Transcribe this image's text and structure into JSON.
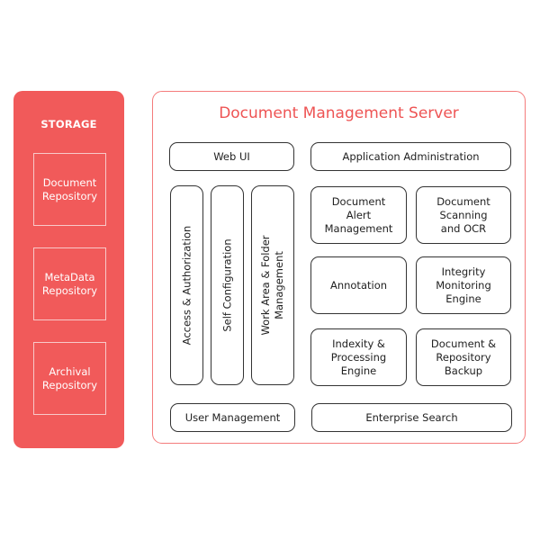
{
  "storage": {
    "title": "STORAGE",
    "repositories": [
      {
        "line1": "Document",
        "line2": "Repository"
      },
      {
        "line1": "MetaData",
        "line2": "Repository"
      },
      {
        "line1": "Archival",
        "line2": "Repository"
      }
    ]
  },
  "server": {
    "title": "Document Management Server",
    "web_ui": "Web UI",
    "app_admin": "Application Administration",
    "vertical": [
      {
        "line1": "Access & Authorization",
        "line2": ""
      },
      {
        "line1": "Self Configuration",
        "line2": ""
      },
      {
        "line1": "Work Area & Folder",
        "line2": "Management"
      }
    ],
    "modules": [
      {
        "lines": [
          "Document",
          "Alert",
          "Management"
        ]
      },
      {
        "lines": [
          "Document",
          "Scanning",
          "and OCR"
        ]
      },
      {
        "lines": [
          "Annotation"
        ]
      },
      {
        "lines": [
          "Integrity",
          "Monitoring",
          "Engine"
        ]
      },
      {
        "lines": [
          "Indexity &",
          "Processing",
          "Engine"
        ]
      },
      {
        "lines": [
          "Document &",
          "Repository",
          "Backup"
        ]
      }
    ],
    "user_management": "User Management",
    "enterprise_search": "Enterprise Search"
  },
  "colors": {
    "accent": "#f15a5a",
    "border": "#333333"
  }
}
